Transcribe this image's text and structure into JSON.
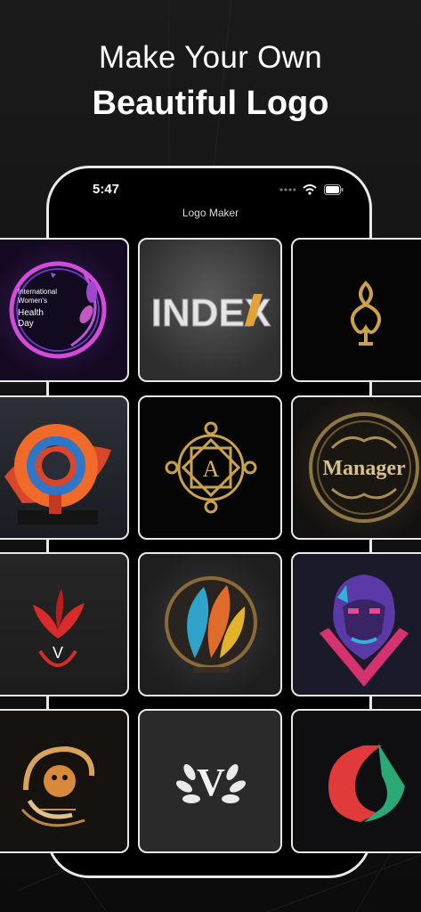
{
  "headline": {
    "line1": "Make Your Own",
    "line2": "Beautiful Logo"
  },
  "status_bar": {
    "time": "5:47",
    "icons": [
      "signal-dots-icon",
      "wifi-icon",
      "battery-icon"
    ]
  },
  "app": {
    "title": "Logo Maker"
  },
  "tiles": [
    {
      "name": "womens-health-day-logo",
      "texts": [
        "International",
        "Women's",
        "Health",
        "Day"
      ]
    },
    {
      "name": "index-logo",
      "texts": [
        "INDEX"
      ]
    },
    {
      "name": "gold-ornament-logo",
      "texts": []
    },
    {
      "name": "3d-ring-sculpture-logo",
      "texts": []
    },
    {
      "name": "gold-mandala-a-logo",
      "texts": [
        "A"
      ]
    },
    {
      "name": "manager-emblem-logo",
      "texts": [
        "Manager"
      ]
    },
    {
      "name": "red-flower-v-logo",
      "texts": [
        "V"
      ]
    },
    {
      "name": "colorful-feather-logo",
      "texts": []
    },
    {
      "name": "gorilla-logo",
      "texts": []
    },
    {
      "name": "tiger-swirl-logo",
      "texts": []
    },
    {
      "name": "laurel-v-logo",
      "texts": [
        "V"
      ]
    },
    {
      "name": "red-green-shape-logo",
      "texts": []
    }
  ],
  "colors": {
    "background": "#141414",
    "phone_border": "#e9e9e9",
    "gold": "#c9a24b"
  }
}
